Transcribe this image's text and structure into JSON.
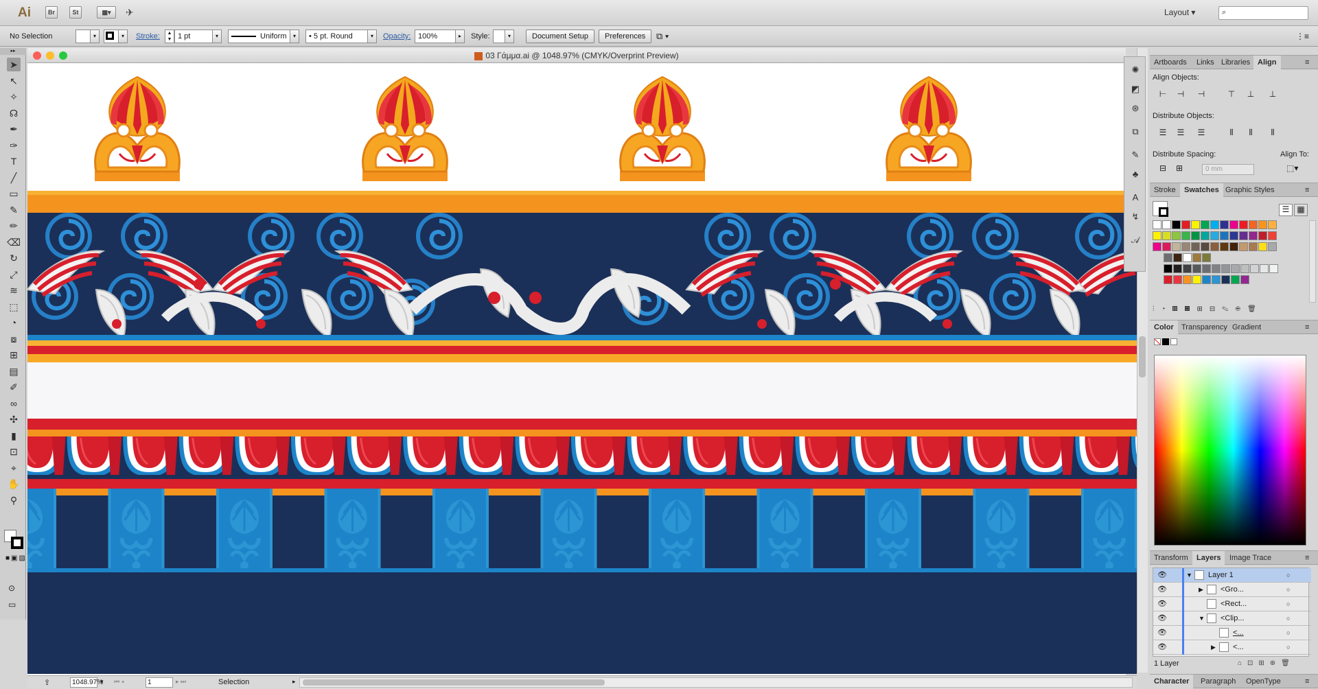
{
  "app": {
    "logo": "Ai",
    "bridge": "Br",
    "stock": "St",
    "workspace": "Layout"
  },
  "control_bar": {
    "selection": "No Selection",
    "stroke_label": "Stroke:",
    "stroke_weight": "1 pt",
    "profile": "Uniform",
    "brush": "5 pt. Round",
    "opacity_label": "Opacity:",
    "opacity": "100%",
    "style_label": "Style:",
    "doc_setup": "Document Setup",
    "preferences": "Preferences"
  },
  "document": {
    "title": "03 Γάμμα.ai @ 1048.97% (CMYK/Overprint Preview)"
  },
  "status": {
    "zoom": "1048.97%",
    "artboard": "1",
    "tool": "Selection"
  },
  "align_panel": {
    "tabs": [
      "Artboards",
      "Links",
      "Libraries",
      "Align"
    ],
    "align_objects": "Align Objects:",
    "distribute_objects": "Distribute Objects:",
    "distribute_spacing": "Distribute Spacing:",
    "align_to": "Align To:",
    "spacing_value": "0 mm"
  },
  "swatches_panel": {
    "tabs": [
      "Stroke",
      "Swatches",
      "Graphic Styles"
    ]
  },
  "color_panel": {
    "tabs": [
      "Color",
      "Transparency",
      "Gradient"
    ]
  },
  "layers_panel": {
    "tabs": [
      "Transform",
      "Layers",
      "Image Trace"
    ],
    "rows": [
      "Layer 1",
      "<Gro...",
      "<Rect...",
      "<Clip...",
      "<...",
      "<..."
    ],
    "count": "1 Layer"
  },
  "char_panel": {
    "tabs": [
      "Character",
      "Paragraph",
      "OpenType"
    ]
  },
  "colors": {
    "navy": "#1b3058",
    "orange": "#f4941f",
    "red": "#d81f2c",
    "blue": "#1d84c9",
    "light_blue": "#2c95d3"
  },
  "icons": [
    "selection-icon",
    "direct-selection-icon",
    "magic-wand-icon",
    "lasso-icon",
    "pen-icon",
    "curvature-icon",
    "type-icon",
    "line-icon",
    "rectangle-icon",
    "paintbrush-icon",
    "pencil-icon",
    "eraser-icon",
    "rotate-icon",
    "scale-icon",
    "warp-icon",
    "free-transform-icon",
    "shape-builder-icon",
    "perspective-icon",
    "mesh-icon",
    "gradient-icon",
    "eyedropper-icon",
    "blend-icon",
    "symbol-sprayer-icon",
    "graph-icon",
    "artboard-icon",
    "slice-icon",
    "hand-icon",
    "zoom-icon"
  ]
}
